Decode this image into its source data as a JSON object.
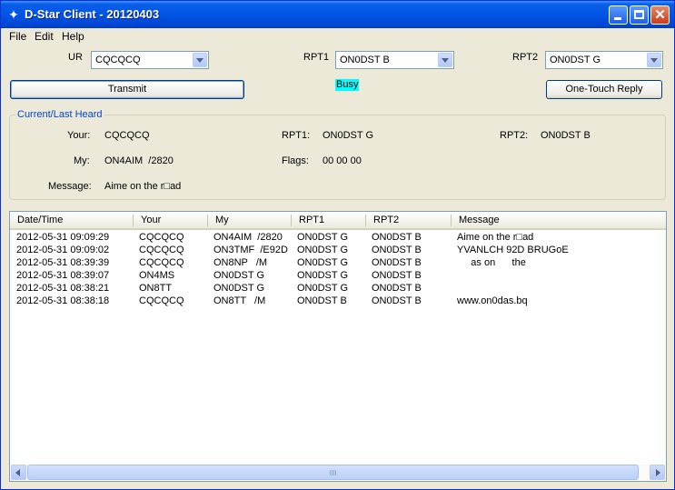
{
  "window": {
    "title": "D-Star Client - 20120403"
  },
  "menu": [
    "File",
    "Edit",
    "Help"
  ],
  "routing": {
    "ur_label": "UR",
    "ur_value": "CQCQCQ",
    "rpt1_label": "RPT1",
    "rpt1_value": "ON0DST B",
    "rpt2_label": "RPT2",
    "rpt2_value": "ON0DST G"
  },
  "buttons": {
    "transmit": "Transmit",
    "one_touch_reply": "One-Touch Reply"
  },
  "status": {
    "busy": "Busy",
    "busy_color": "#00ffff"
  },
  "last_heard": {
    "title": "Current/Last Heard",
    "your_label": "Your:",
    "your_value": "CQCQCQ",
    "rpt1_label": "RPT1:",
    "rpt1_value": "ON0DST G",
    "rpt2_label": "RPT2:",
    "rpt2_value": "ON0DST B",
    "my_label": "My:",
    "my_value": "ON4AIM  /2820",
    "flags_label": "Flags:",
    "flags_value": "00 00 00",
    "message_label": "Message:",
    "message_value": "Aime on the r□ad"
  },
  "log": {
    "columns": [
      "Date/Time",
      "Your",
      "My",
      "RPT1",
      "RPT2",
      "Message"
    ],
    "rows": [
      [
        "2012-05-31 09:09:29",
        "CQCQCQ",
        "ON4AIM  /2820",
        "ON0DST G",
        "ON0DST B",
        "Aime on the r□ad"
      ],
      [
        "2012-05-31 09:09:02",
        "CQCQCQ",
        "ON3TMF  /E92D",
        "ON0DST G",
        "ON0DST B",
        "YVANLCH 92D BRUGoE"
      ],
      [
        "2012-05-31 08:39:39",
        "CQCQCQ",
        "ON8NP   /M",
        "ON0DST G",
        "ON0DST B",
        "     as on      the"
      ],
      [
        "2012-05-31 08:39:07",
        "ON4MS",
        "ON0DST G",
        "ON0DST G",
        "ON0DST B",
        ""
      ],
      [
        "2012-05-31 08:38:21",
        "ON8TT",
        "ON0DST G",
        "ON0DST G",
        "ON0DST B",
        ""
      ],
      [
        "2012-05-31 08:38:18",
        "CQCQCQ",
        "ON8TT   /M",
        "ON0DST B",
        "ON0DST B",
        "www.on0das.bq"
      ]
    ]
  }
}
